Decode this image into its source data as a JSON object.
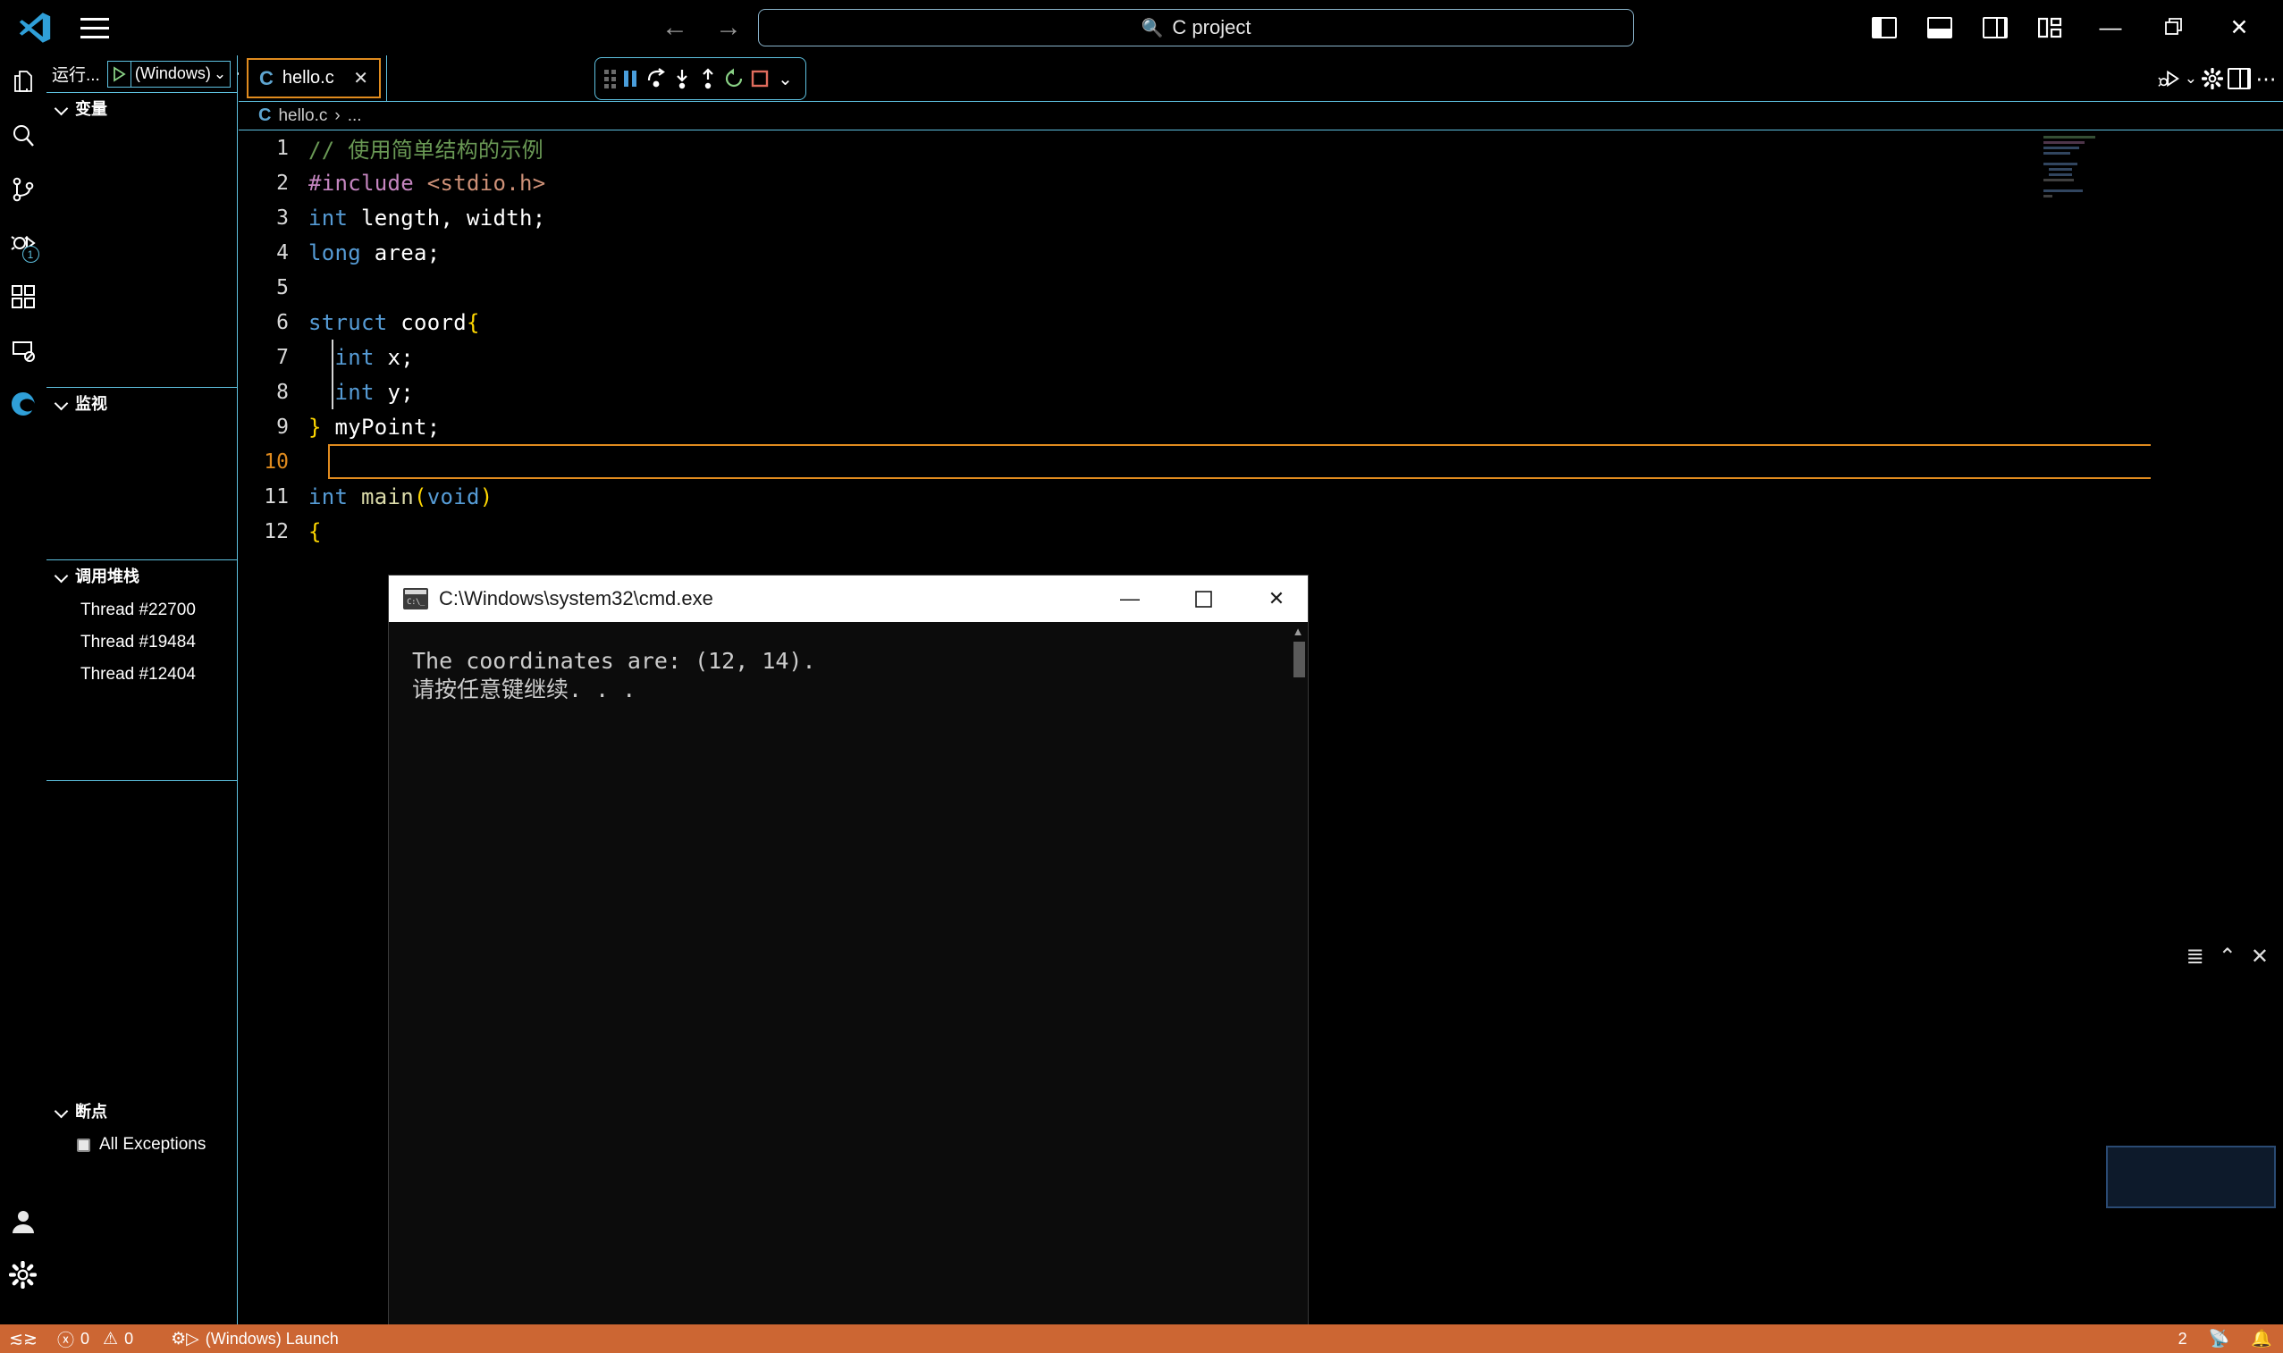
{
  "titlebar": {
    "app_icon": "vscode-logo",
    "menu_icon": "hamburger-menu-icon",
    "back_arrow": "←",
    "forward_arrow": "→",
    "search_value": "C project",
    "search_icon": "magnifier-icon",
    "layout_buttons": [
      {
        "name": "toggle-primary-sidebar",
        "icon": "panel-left-icon"
      },
      {
        "name": "toggle-panel",
        "icon": "panel-bottom-icon"
      },
      {
        "name": "toggle-secondary-sidebar",
        "icon": "panel-right-icon"
      },
      {
        "name": "customize-layout",
        "icon": "layout-grid-icon"
      }
    ],
    "window_controls": {
      "minimize": "—",
      "maximize": "❐",
      "close": "✕"
    }
  },
  "activitybar": {
    "items": [
      {
        "name": "explorer",
        "icon": "files-icon"
      },
      {
        "name": "search",
        "icon": "search-icon"
      },
      {
        "name": "source-control",
        "icon": "source-control-icon"
      },
      {
        "name": "run-and-debug",
        "icon": "debug-icon",
        "badge": "1",
        "active": true
      },
      {
        "name": "extensions",
        "icon": "extensions-icon"
      },
      {
        "name": "remote-explorer",
        "icon": "remote-icon"
      },
      {
        "name": "edge-tools",
        "icon": "edge-icon"
      }
    ],
    "bottom_items": [
      {
        "name": "accounts",
        "icon": "account-icon"
      },
      {
        "name": "manage-settings",
        "icon": "gear-icon"
      }
    ]
  },
  "sidebar": {
    "run_toolbar": {
      "label": "运行...",
      "play_icon": "play-triangle-icon",
      "config_name": "(Windows)",
      "chevron": "⌄",
      "gear_icon": "gear-icon",
      "more_icon": "ellipsis-icon"
    },
    "sections": [
      {
        "name": "variables",
        "title": "变量",
        "items": []
      },
      {
        "name": "watch",
        "title": "监视",
        "items": []
      },
      {
        "name": "call-stack",
        "title": "调用堆栈",
        "items": [
          "Thread #22700",
          "Thread #19484",
          "Thread #12404"
        ]
      },
      {
        "name": "breakpoints",
        "title": "断点",
        "items": [
          {
            "label": "All Exceptions",
            "checked": false
          }
        ]
      }
    ]
  },
  "editor": {
    "tabs": [
      {
        "name": "tab-hello-c",
        "icon_letter": "C",
        "label": "hello.c",
        "close": "✕",
        "active": true,
        "focused": true
      }
    ],
    "breadcrumb": {
      "icon_letter": "C",
      "file": "hello.c",
      "sep": "›",
      "rest": "..."
    },
    "right_tools": [
      {
        "name": "run-or-debug-button",
        "icon": "run-debug-icon",
        "chevron": "⌄"
      },
      {
        "name": "editor-settings-button",
        "icon": "gear-icon"
      },
      {
        "name": "split-editor-button",
        "icon": "split-editor-icon"
      },
      {
        "name": "more-actions-button",
        "icon": "ellipsis-icon"
      }
    ],
    "debug_toolbar": {
      "drag_handle": "drag-dots-icon",
      "buttons": [
        {
          "name": "pause-button",
          "icon": "pause-icon",
          "color": "#4a9edb"
        },
        {
          "name": "step-over-button",
          "icon": "step-over-icon",
          "color": "#ffffff"
        },
        {
          "name": "step-into-button",
          "icon": "step-into-icon",
          "color": "#ffffff"
        },
        {
          "name": "step-out-button",
          "icon": "step-out-icon",
          "color": "#ffffff"
        },
        {
          "name": "restart-button",
          "icon": "restart-icon",
          "color": "#89d185"
        },
        {
          "name": "stop-button",
          "icon": "stop-square-icon",
          "color": "#e06c5d"
        },
        {
          "name": "debug-more-button",
          "icon": "chevron-down-icon",
          "color": "#ffffff"
        }
      ]
    },
    "code": {
      "active_line": 10,
      "lines": [
        {
          "n": 1,
          "tokens": [
            {
              "t": "// 使用简单结构的示例",
              "c": "c-comment"
            }
          ]
        },
        {
          "n": 2,
          "tokens": [
            {
              "t": "#include",
              "c": "c-pre"
            },
            {
              "t": " ",
              "c": "c-ident"
            },
            {
              "t": "<stdio.h>",
              "c": "c-string"
            }
          ]
        },
        {
          "n": 3,
          "tokens": [
            {
              "t": "int",
              "c": "c-kw"
            },
            {
              "t": " length, width;",
              "c": "c-ident"
            }
          ]
        },
        {
          "n": 4,
          "tokens": [
            {
              "t": "long",
              "c": "c-kw"
            },
            {
              "t": " area;",
              "c": "c-ident"
            }
          ]
        },
        {
          "n": 5,
          "tokens": []
        },
        {
          "n": 6,
          "tokens": [
            {
              "t": "struct",
              "c": "c-kw"
            },
            {
              "t": " coord",
              "c": "c-ident"
            },
            {
              "t": "{",
              "c": "c-brace"
            }
          ]
        },
        {
          "n": 7,
          "tokens": [
            {
              "t": "  ",
              "c": "c-ident"
            },
            {
              "t": "int",
              "c": "c-kw"
            },
            {
              "t": " x;",
              "c": "c-ident"
            }
          ]
        },
        {
          "n": 8,
          "tokens": [
            {
              "t": "  ",
              "c": "c-ident"
            },
            {
              "t": "int",
              "c": "c-kw"
            },
            {
              "t": " y;",
              "c": "c-ident"
            }
          ]
        },
        {
          "n": 9,
          "tokens": [
            {
              "t": "}",
              "c": "c-brace"
            },
            {
              "t": " myPoint;",
              "c": "c-ident"
            }
          ]
        },
        {
          "n": 10,
          "tokens": []
        },
        {
          "n": 11,
          "tokens": [
            {
              "t": "int",
              "c": "c-kw"
            },
            {
              "t": " ",
              "c": "c-ident"
            },
            {
              "t": "main",
              "c": "c-fn"
            },
            {
              "t": "(",
              "c": "c-paren"
            },
            {
              "t": "void",
              "c": "c-kw"
            },
            {
              "t": ")",
              "c": "c-paren"
            }
          ]
        },
        {
          "n": 12,
          "tokens": [
            {
              "t": "{",
              "c": "c-brace"
            }
          ]
        }
      ]
    }
  },
  "cmd_window": {
    "icon": "cmd-console-icon",
    "title": "C:\\Windows\\system32\\cmd.exe",
    "controls": {
      "minimize": "—",
      "maximize": "☐",
      "close": "✕"
    },
    "output_lines": [
      "The coordinates are: (12, 14).",
      "请按任意键继续. . ."
    ],
    "scroll_up": "▲",
    "scroll_down": "▼"
  },
  "statusbar": {
    "background": "#cc6633",
    "remote_icon": "remote-window-icon",
    "errors_icon": "error-circle-icon",
    "errors_count": "0",
    "warnings_icon": "warning-triangle-icon",
    "warnings_count": "0",
    "debug_icon": "debug-session-icon",
    "debug_session": "(Windows) Launch",
    "right_count": "2",
    "right_broadcast_icon": "broadcast-icon",
    "right_bell_icon": "bell-icon"
  }
}
